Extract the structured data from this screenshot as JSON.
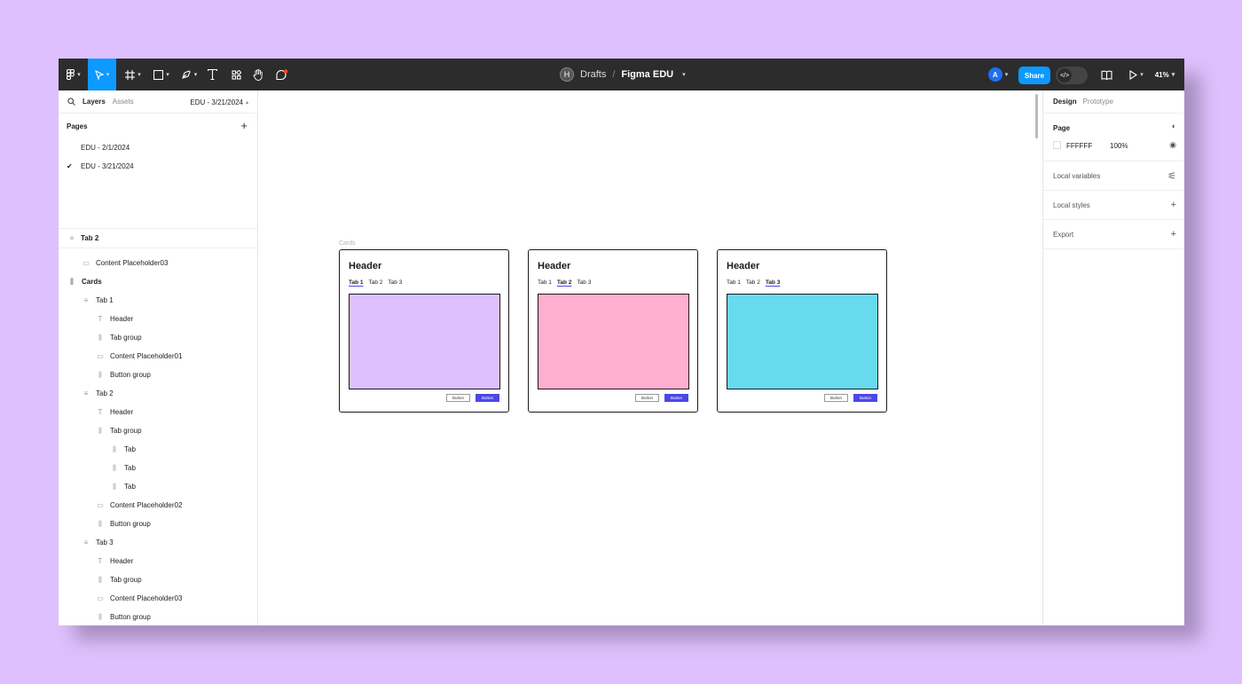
{
  "toolbar": {
    "breadcrumb": {
      "team_initial": "H",
      "project": "Drafts",
      "separator": "/",
      "file": "Figma EDU"
    },
    "user_initial": "A",
    "share_label": "Share",
    "zoom": "41%"
  },
  "left_panel": {
    "tabs": {
      "layers": "Layers",
      "assets": "Assets"
    },
    "current_page": "EDU - 3/21/2024",
    "pages_title": "Pages",
    "pages": [
      {
        "label": "EDU - 2/1/2024"
      },
      {
        "label": "EDU - 3/21/2024"
      }
    ],
    "selected_layer": "Tab 2",
    "layers": [
      {
        "label": "Content Placeholder03"
      },
      {
        "label": "Cards"
      },
      {
        "label": "Tab 1"
      },
      {
        "label": "Header"
      },
      {
        "label": "Tab group"
      },
      {
        "label": "Content Placeholder01"
      },
      {
        "label": "Button group"
      },
      {
        "label": "Tab 2"
      },
      {
        "label": "Header"
      },
      {
        "label": "Tab group"
      },
      {
        "label": "Tab"
      },
      {
        "label": "Tab"
      },
      {
        "label": "Tab"
      },
      {
        "label": "Content Placeholder02"
      },
      {
        "label": "Button group"
      },
      {
        "label": "Tab 3"
      },
      {
        "label": "Header"
      },
      {
        "label": "Tab group"
      },
      {
        "label": "Content Placeholder03"
      },
      {
        "label": "Button group"
      }
    ]
  },
  "right_panel": {
    "tabs": {
      "design": "Design",
      "prototype": "Prototype"
    },
    "page_section": "Page",
    "bg_color": "FFFFFF",
    "bg_opacity": "100%",
    "local_variables": "Local variables",
    "local_styles": "Local styles",
    "export": "Export"
  },
  "canvas": {
    "frame_label": "Cards",
    "cards": [
      {
        "header": "Header",
        "tabs": [
          "Tab 1",
          "Tab 2",
          "Tab 3"
        ],
        "active_tab": 0,
        "color": "#dfc0fe",
        "button_secondary": "Button",
        "button_primary": "Button"
      },
      {
        "header": "Header",
        "tabs": [
          "Tab 1",
          "Tab 2",
          "Tab 3"
        ],
        "active_tab": 1,
        "color": "#ffafd1",
        "button_secondary": "Button",
        "button_primary": "Button"
      },
      {
        "header": "Header",
        "tabs": [
          "Tab 1",
          "Tab 2",
          "Tab 3"
        ],
        "active_tab": 2,
        "color": "#66dbee",
        "button_secondary": "Button",
        "button_primary": "Button"
      }
    ]
  },
  "colors": {
    "accent": "#0d99ff",
    "button_primary": "#4b47e6",
    "toolbar": "#2c2c2c",
    "background": "#dfc0fe"
  },
  "icons": [
    "figma-menu-icon",
    "move-tool-icon",
    "frame-tool-icon",
    "shape-tool-icon",
    "pen-tool-icon",
    "text-tool-icon",
    "resources-icon",
    "hand-tool-icon",
    "comment-icon",
    "library-icon",
    "present-icon"
  ]
}
